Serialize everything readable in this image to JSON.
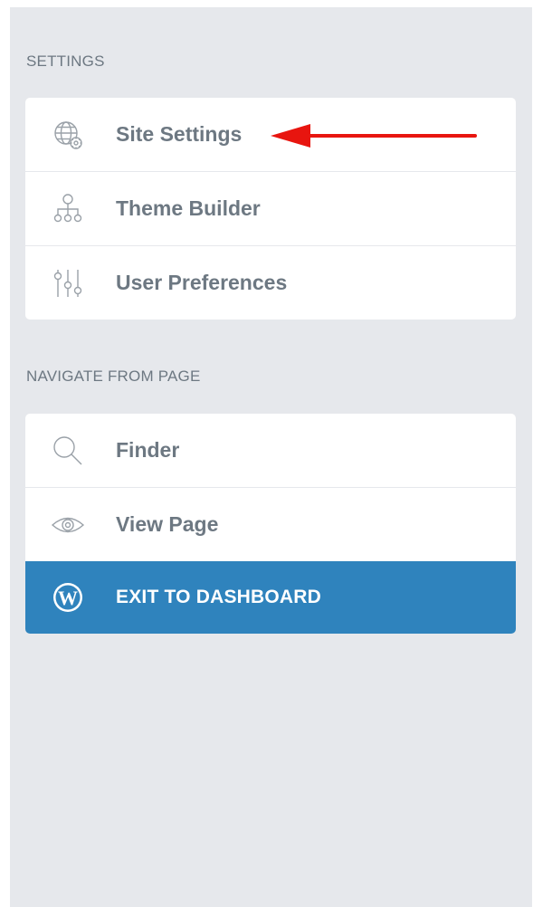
{
  "settings": {
    "section_title": "SETTINGS",
    "items": [
      {
        "label": "Site Settings",
        "icon": "globe-gear-icon"
      },
      {
        "label": "Theme Builder",
        "icon": "sitemap-icon"
      },
      {
        "label": "User Preferences",
        "icon": "sliders-icon"
      }
    ]
  },
  "navigate": {
    "section_title": "NAVIGATE FROM PAGE",
    "items": [
      {
        "label": "Finder",
        "icon": "search-icon"
      },
      {
        "label": "View Page",
        "icon": "eye-icon"
      },
      {
        "label": "EXIT TO DASHBOARD",
        "icon": "wordpress-icon"
      }
    ]
  },
  "annotation": {
    "icon": "red-arrow-icon",
    "color": "#e8150f"
  },
  "colors": {
    "panel_bg": "#e6e8ec",
    "text": "#6d7882",
    "exit_bg": "#2f83bd"
  }
}
